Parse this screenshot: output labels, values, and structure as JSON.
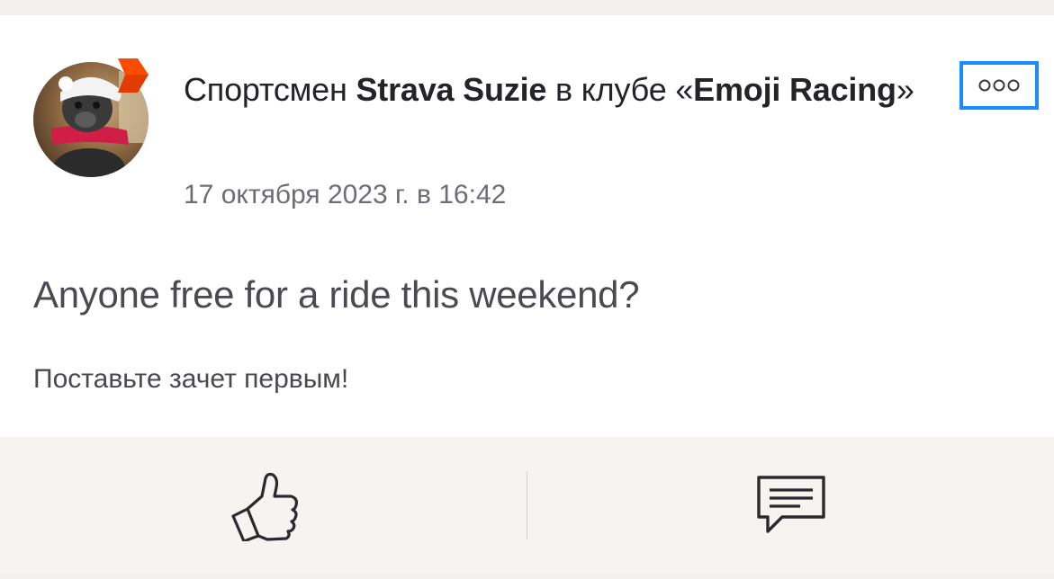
{
  "post": {
    "header_prefix": "Спортсмен ",
    "athlete_name": "Strava Suzie",
    "header_middle": " в клубе «",
    "club_name": "Emoji Racing",
    "header_suffix": "»",
    "timestamp": "17 октября 2023 г. в 16:42",
    "title": "Anyone free for a ride this weekend?",
    "kudos_prompt": "Поставьте зачет первым!"
  },
  "icons": {
    "avatar_badge": "strava-badge-icon",
    "more": "more-options-icon",
    "like": "thumbs-up-icon",
    "comment": "comment-icon"
  },
  "colors": {
    "badge": "#fc4c02",
    "focus_ring": "#1a8cff",
    "text_primary": "#242428",
    "text_secondary": "#6d6d78",
    "background": "#f2f1ee"
  }
}
